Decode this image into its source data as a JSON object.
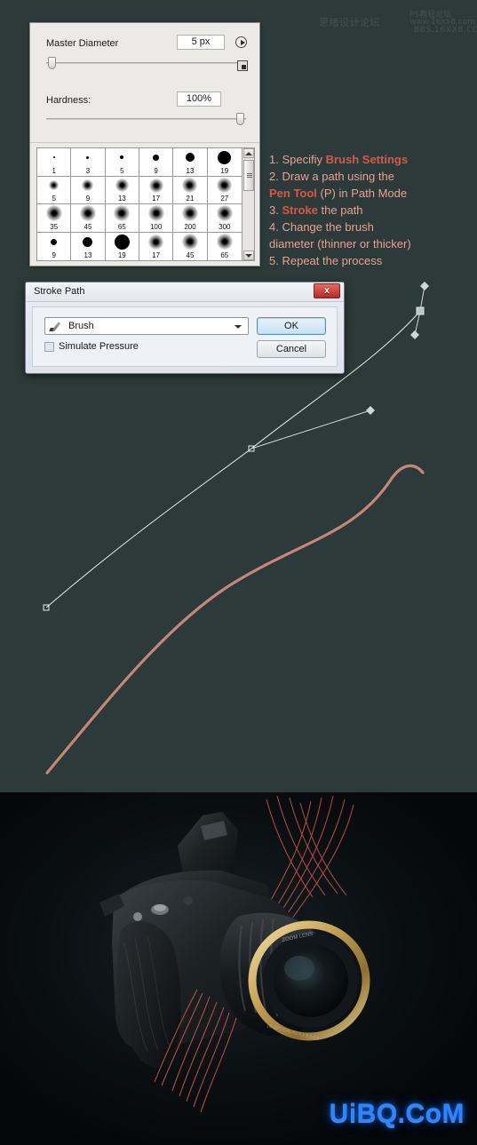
{
  "background": {
    "stage_color": "#2c3b39",
    "photo_color": "#05080a"
  },
  "watermark": {
    "line_cn": "思绪设计论坛",
    "line_url": "www.16xx8.com",
    "line_ps": "PS教程论坛",
    "line_bbs": "BBS.16XX8.COM"
  },
  "brush_panel": {
    "master_diameter_label": "Master Diameter",
    "master_diameter_value": "5 px",
    "hardness_label": "Hardness:",
    "hardness_value": "100%",
    "menu_button_icon": "circle-arrow-icon",
    "panel_button_icon": "new-brush-icon",
    "scroll_up_icon": "scroll-up-arrow-icon",
    "scroll_down_icon": "scroll-down-arrow-icon",
    "presets": [
      {
        "size": "1",
        "dot": 2,
        "soft": false
      },
      {
        "size": "3",
        "dot": 3,
        "soft": false
      },
      {
        "size": "5",
        "dot": 4,
        "soft": false
      },
      {
        "size": "9",
        "dot": 7,
        "soft": false
      },
      {
        "size": "13",
        "dot": 10,
        "soft": false
      },
      {
        "size": "19",
        "dot": 15,
        "soft": false
      },
      {
        "size": "5",
        "dot": 3,
        "soft": true
      },
      {
        "size": "9",
        "dot": 5,
        "soft": true
      },
      {
        "size": "13",
        "dot": 7,
        "soft": true
      },
      {
        "size": "17",
        "dot": 8,
        "soft": true
      },
      {
        "size": "21",
        "dot": 9,
        "soft": true
      },
      {
        "size": "27",
        "dot": 9,
        "soft": true
      },
      {
        "size": "35",
        "dot": 10,
        "soft": true
      },
      {
        "size": "45",
        "dot": 10,
        "soft": true
      },
      {
        "size": "65",
        "dot": 10,
        "soft": true
      },
      {
        "size": "100",
        "dot": 10,
        "soft": true
      },
      {
        "size": "200",
        "dot": 10,
        "soft": true
      },
      {
        "size": "300",
        "dot": 10,
        "soft": true
      },
      {
        "size": "9",
        "dot": 7,
        "soft": false
      },
      {
        "size": "13",
        "dot": 11,
        "soft": false
      },
      {
        "size": "19",
        "dot": 17,
        "soft": false
      },
      {
        "size": "17",
        "dot": 9,
        "soft": true
      },
      {
        "size": "45",
        "dot": 10,
        "soft": true
      },
      {
        "size": "65",
        "dot": 10,
        "soft": true
      }
    ]
  },
  "stroke_dialog": {
    "title": "Stroke Path",
    "close_label": "x",
    "tool_value": "Brush",
    "tool_icon": "brush-icon",
    "caret_icon": "chevron-down-icon",
    "simulate_pressure_label": "Simulate Pressure",
    "simulate_pressure_checked": false,
    "ok_label": "OK",
    "cancel_label": "Cancel"
  },
  "instructions": {
    "text_color": "#e8a094",
    "accent_color": "#d9574a",
    "steps": [
      {
        "num": "1. ",
        "pre": "Specifiy ",
        "bold": "Brush Settings",
        "post": ""
      },
      {
        "num": "2. ",
        "pre": "Draw a path using the",
        "bold": "",
        "post": ""
      },
      {
        "num": "",
        "pre": "",
        "bold": "Pen Tool",
        "post": " (P) in Path Mode"
      },
      {
        "num": "3. ",
        "pre": "",
        "bold": "Stroke",
        "post": " the path"
      },
      {
        "num": "4. ",
        "pre": "Change the brush",
        "bold": "",
        "post": ""
      },
      {
        "num": "",
        "pre": "diameter (thinner or thicker)",
        "bold": "",
        "post": ""
      },
      {
        "num": "5. ",
        "pre": "Repeat the process",
        "bold": "",
        "post": ""
      }
    ]
  },
  "paths": {
    "work_path_color": "#e6ebe8",
    "stroked_path_color": "#c98579",
    "anchor_fill": "#b9c6c2",
    "anchor_count": 3
  },
  "photo": {
    "subject": "dslr-camera",
    "lens_ring_color": "#c9a75a",
    "streak_color": "#d9574a"
  },
  "logo": {
    "text": "UiBQ.CoM",
    "color": "#2e86ff"
  }
}
